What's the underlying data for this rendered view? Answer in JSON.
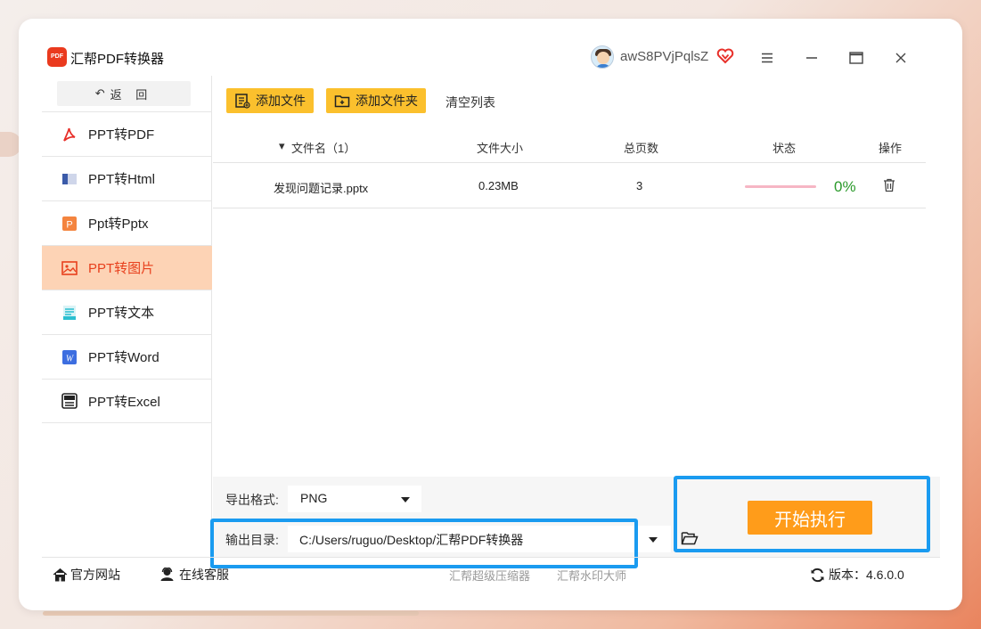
{
  "app": {
    "title": "汇帮PDF转换器",
    "username": "awS8PVjPqlsZ",
    "logo_text": "PDF"
  },
  "sidebar": {
    "back_label": "返 回",
    "items": [
      {
        "label": "PPT转PDF",
        "icon": "pdf-icon",
        "active": false
      },
      {
        "label": "PPT转Html",
        "icon": "html-icon",
        "active": false
      },
      {
        "label": "Ppt转Pptx",
        "icon": "pptx-icon",
        "active": false
      },
      {
        "label": "PPT转图片",
        "icon": "image-icon",
        "active": true
      },
      {
        "label": "PPT转文本",
        "icon": "text-icon",
        "active": false
      },
      {
        "label": "PPT转Word",
        "icon": "word-icon",
        "active": false
      },
      {
        "label": "PPT转Excel",
        "icon": "excel-icon",
        "active": false
      }
    ]
  },
  "toolbar": {
    "add_file": "添加文件",
    "add_folder": "添加文件夹",
    "clear_list": "清空列表"
  },
  "table": {
    "headers": {
      "name": "文件名（1）",
      "size": "文件大小",
      "pages": "总页数",
      "status": "状态",
      "action": "操作"
    },
    "rows": [
      {
        "name": "发现问题记录.pptx",
        "size": "0.23MB",
        "pages": "3",
        "progress_percent": 0,
        "status_text": "0%"
      }
    ]
  },
  "output": {
    "format_label": "导出格式:",
    "format_value": "PNG",
    "dir_label": "输出目录:",
    "dir_value": "C:/Users/ruguo/Desktop/汇帮PDF转换器",
    "start_label": "开始执行"
  },
  "footer": {
    "website": "官方网站",
    "support": "在线客服",
    "link1": "汇帮超级压缩器",
    "link2": "汇帮水印大师",
    "version_label": "版本：",
    "version_value": "4.6.0.0"
  },
  "colors": {
    "accent": "#e8401d",
    "active_bg": "#fdd3b5",
    "yellow_button": "#fbc02d",
    "start_button": "#ff9c1a",
    "highlight": "#1a9bf0",
    "progress_green": "#2b9a2b"
  }
}
